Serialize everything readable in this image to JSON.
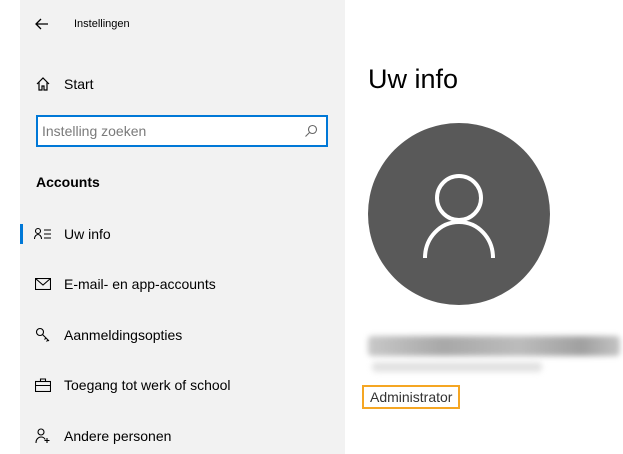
{
  "window": {
    "title": "Instellingen"
  },
  "sidebar": {
    "home_label": "Start",
    "search_placeholder": "Instelling zoeken",
    "section_heading": "Accounts",
    "items": [
      {
        "label": "Uw info",
        "icon": "person-info-icon",
        "active": true
      },
      {
        "label": "E-mail- en app-accounts",
        "icon": "mail-icon",
        "active": false
      },
      {
        "label": "Aanmeldingsopties",
        "icon": "key-icon",
        "active": false
      },
      {
        "label": "Toegang tot werk of school",
        "icon": "briefcase-icon",
        "active": false
      },
      {
        "label": "Andere personen",
        "icon": "add-person-icon",
        "active": false
      }
    ]
  },
  "main": {
    "title": "Uw info",
    "role": "Administrator"
  },
  "colors": {
    "accent": "#0078d7",
    "highlight": "#f5a623",
    "avatar_bg": "#595959",
    "sidebar_bg": "#f2f2f2"
  }
}
